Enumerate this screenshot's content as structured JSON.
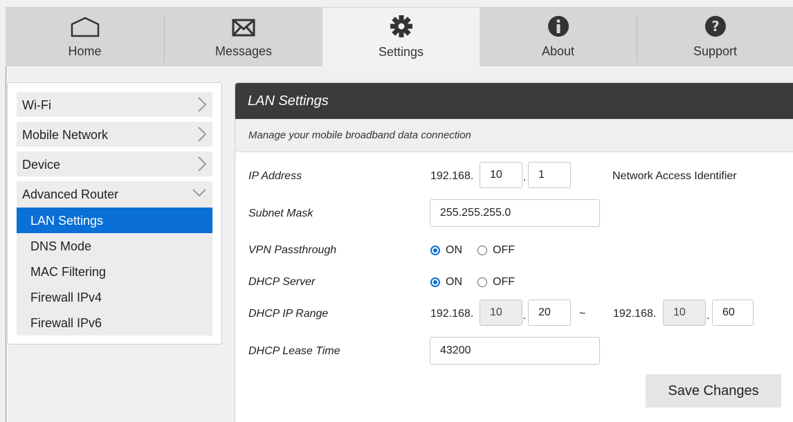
{
  "nav": {
    "tabs": [
      {
        "label": "Home",
        "icon": "home-icon"
      },
      {
        "label": "Messages",
        "icon": "envelope-icon"
      },
      {
        "label": "Settings",
        "icon": "gear-icon"
      },
      {
        "label": "About",
        "icon": "info-icon"
      },
      {
        "label": "Support",
        "icon": "question-icon"
      }
    ],
    "active": "Settings"
  },
  "sidebar": {
    "items": [
      {
        "label": "Wi-Fi"
      },
      {
        "label": "Mobile Network"
      },
      {
        "label": "Device"
      },
      {
        "label": "Advanced Router"
      }
    ],
    "subitems": [
      {
        "label": "LAN Settings"
      },
      {
        "label": "DNS Mode"
      },
      {
        "label": "MAC Filtering"
      },
      {
        "label": "Firewall IPv4"
      },
      {
        "label": "Firewall IPv6"
      }
    ],
    "active_subitem": "LAN Settings"
  },
  "panel": {
    "title": "LAN Settings",
    "subtitle": "Manage your mobile broadband data connection",
    "fields": {
      "ip_address": {
        "label": "IP Address",
        "prefix": "192.168.",
        "octet3": "10",
        "octet4": "1",
        "note": "Network Access Identifier"
      },
      "subnet_mask": {
        "label": "Subnet Mask",
        "value": "255.255.255.0"
      },
      "vpn_passthrough": {
        "label": "VPN Passthrough",
        "on_label": "ON",
        "off_label": "OFF",
        "selected": "ON"
      },
      "dhcp_server": {
        "label": "DHCP Server",
        "on_label": "ON",
        "off_label": "OFF",
        "selected": "ON"
      },
      "dhcp_ip_range": {
        "label": "DHCP IP Range",
        "start_prefix": "192.168.",
        "start_octet3": "10",
        "start_octet4": "20",
        "separator": "~",
        "end_prefix": "192.168.",
        "end_octet3": "10",
        "end_octet4": "60",
        "dot": "."
      },
      "dhcp_lease_time": {
        "label": "DHCP Lease Time",
        "value": "43200"
      }
    },
    "save_label": "Save Changes"
  },
  "colors": {
    "accent": "#0a6fd6",
    "header_dark": "#3b3b3b",
    "nav_bg": "#d6d6d6"
  }
}
